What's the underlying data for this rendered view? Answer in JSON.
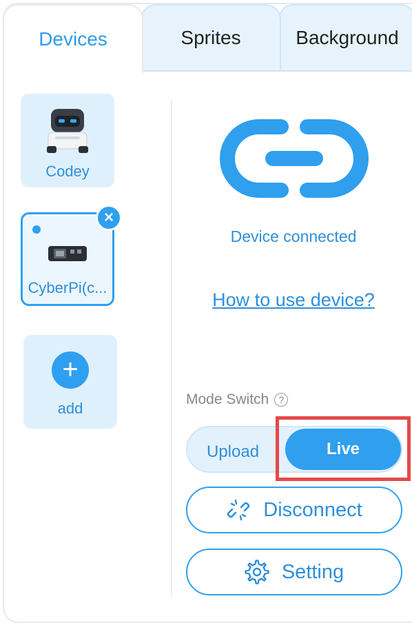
{
  "tabs": [
    {
      "label": "Devices"
    },
    {
      "label": "Sprites"
    },
    {
      "label": "Background"
    }
  ],
  "devices": [
    {
      "label": "Codey",
      "icon": "codey-robot-icon",
      "selected": false
    },
    {
      "label": "CyberPi(c...",
      "icon": "cyberpi-board-icon",
      "selected": true
    }
  ],
  "add_card": {
    "label": "add"
  },
  "connection": {
    "icon": "link-icon",
    "status": "Device connected",
    "help_link": "How to use device?"
  },
  "mode": {
    "label": "Mode Switch",
    "help_icon": "question-icon",
    "upload_label": "Upload",
    "live_label": "Live",
    "selected": "Live"
  },
  "actions": {
    "disconnect_label": "Disconnect",
    "setting_label": "Setting"
  },
  "colors": {
    "accent": "#2f9fee",
    "accent_text": "#2f8fd8",
    "card_bg": "#dff0fd",
    "highlight": "#e24a4a"
  }
}
